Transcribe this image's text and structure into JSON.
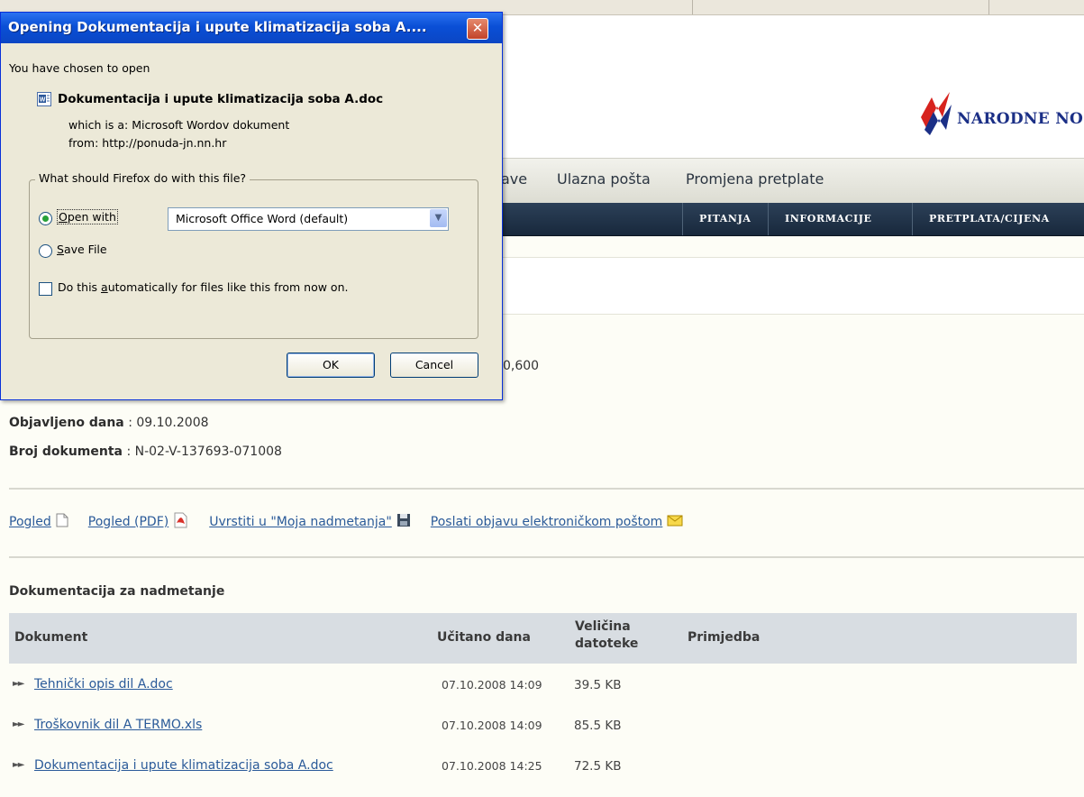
{
  "website": {
    "logo_text": "NARODNE NO",
    "nav_main": [
      "ave",
      "Ulazna pošta",
      "Promjena pretplate"
    ],
    "nav_sub": [
      "PITANJA",
      "INFORMACIJE",
      "PRETPLATA/CIJENA"
    ],
    "partial_value": "0,600",
    "published": {
      "label": "Objavljeno dana",
      "value": ": 09.10.2008"
    },
    "doc_number": {
      "label": "Broj dokumenta",
      "value": ": N-02-V-137693-071008"
    },
    "actions": [
      {
        "label": "Pogled",
        "icon": "document-icon"
      },
      {
        "label": "Pogled (PDF)",
        "icon": "pdf-icon"
      },
      {
        "label": "Uvrstiti u \"Moja nadmetanja\"",
        "icon": "save-disk-icon"
      },
      {
        "label": "Poslati objavu elektroničkom poštom",
        "icon": "email-envelope-icon"
      }
    ],
    "section_title": "Dokumentacija za nadmetanje",
    "table": {
      "headers": {
        "document": "Dokument",
        "uploaded": "Učitano dana",
        "size": "Veličina datoteke",
        "note": "Primjedba"
      },
      "rows": [
        {
          "name": "Tehnički opis dil A.doc",
          "date": "07.10.2008 14:09",
          "size": "39.5 KB"
        },
        {
          "name": "Troškovnik dil A TERMO.xls",
          "date": "07.10.2008 14:09",
          "size": "85.5 KB"
        },
        {
          "name": "Dokumentacija i upute klimatizacija soba A.doc",
          "date": "07.10.2008 14:25",
          "size": "72.5 KB"
        }
      ]
    }
  },
  "dialog": {
    "title": "Opening Dokumentacija i upute klimatizacija soba A....",
    "intro": "You have chosen to open",
    "filename": "Dokumentacija i upute klimatizacija soba A.doc",
    "which_is": "which is a:  Microsoft Wordov dokument",
    "from": "from:  http://ponuda-jn.nn.hr",
    "question": "What should Firefox do with this file?",
    "open_with": {
      "accesskey": "O",
      "rest": "pen with",
      "selected": true
    },
    "app_select": "Microsoft Office Word (default)",
    "save_file": {
      "accesskey": "S",
      "rest": "ave File",
      "selected": false
    },
    "auto": {
      "before": "Do this ",
      "accesskey": "a",
      "rest": "utomatically for files like this from now on.",
      "checked": false
    },
    "ok": "OK",
    "cancel": "Cancel"
  }
}
